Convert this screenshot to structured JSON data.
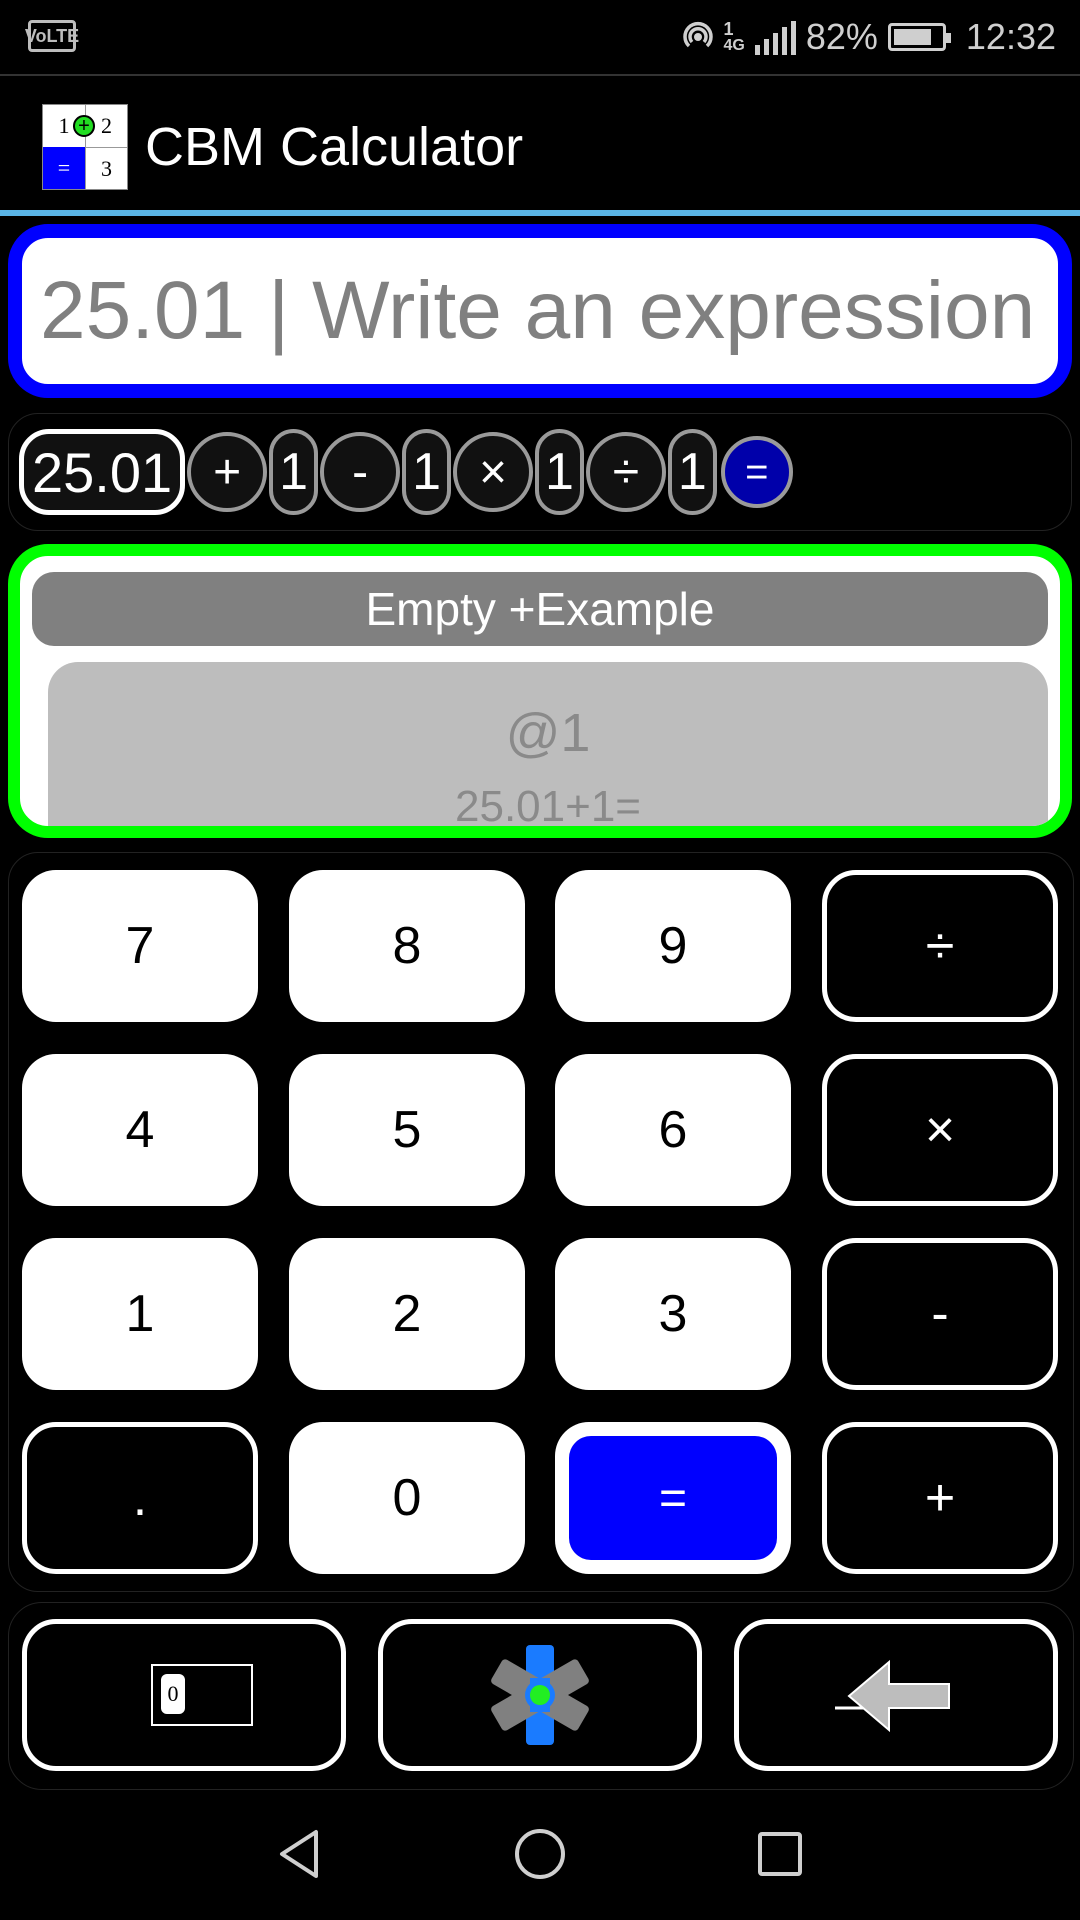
{
  "status_bar": {
    "volte_label": "VoLTE",
    "sim_label": "1",
    "network_label": "4G",
    "battery_percent": "82%",
    "battery_level": 0.82,
    "time": "12:32"
  },
  "app_bar": {
    "logo": {
      "top_left": "1",
      "top_right": "2",
      "bottom_left": "=",
      "bottom_right": "3",
      "center": "+"
    },
    "title": "CBM Calculator"
  },
  "expression": {
    "placeholder": "25.01 | Write an expression",
    "value": ""
  },
  "tokens": [
    {
      "text": "25.01",
      "kind": "num-first"
    },
    {
      "text": "+",
      "kind": "op"
    },
    {
      "text": "1",
      "kind": "num"
    },
    {
      "text": "-",
      "kind": "op"
    },
    {
      "text": "1",
      "kind": "num"
    },
    {
      "text": "×",
      "kind": "op"
    },
    {
      "text": "1",
      "kind": "num"
    },
    {
      "text": "÷",
      "kind": "op"
    },
    {
      "text": "1",
      "kind": "num"
    },
    {
      "text": "=",
      "kind": "eq"
    }
  ],
  "example": {
    "header": "Empty +Example",
    "id": "@1",
    "expression": "25.01+1="
  },
  "keypad": {
    "k7": "7",
    "k8": "8",
    "k9": "9",
    "div": "÷",
    "k4": "4",
    "k5": "5",
    "k6": "6",
    "mul": "×",
    "k1": "1",
    "k2": "2",
    "k3": "3",
    "sub": "-",
    "dot": ".",
    "k0": "0",
    "eq": "=",
    "add": "+"
  },
  "tools": {
    "memory_digit": "0",
    "memory_icon": "memory-register-icon",
    "settings_icon": "asterisk-settings-icon",
    "backspace_icon": "backspace-arrow-icon"
  },
  "colors": {
    "expression_border": "#0000ff",
    "example_border": "#00ff00",
    "equals_key": "#0000ff",
    "appbar_underline": "#5ab4e6"
  }
}
